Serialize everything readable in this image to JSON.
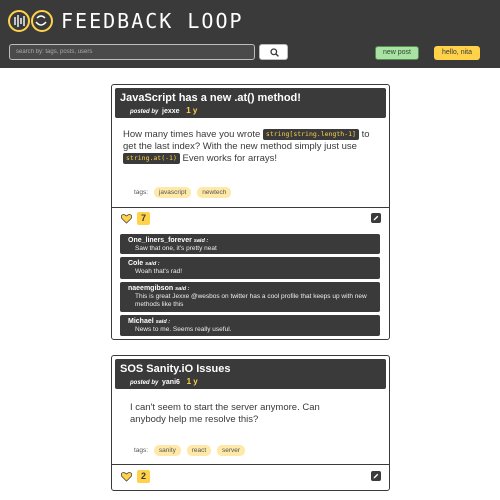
{
  "header": {
    "brand": "FEEDBACK LOOP",
    "search_placeholder": "search by: tags, posts, users",
    "new_post_label": "new post",
    "user_label": "hello, nita"
  },
  "posts": [
    {
      "title": "JavaScript has a new .at() method!",
      "posted_by_label": "posted by",
      "author": "jexxe",
      "age": "1 y",
      "body_1": "How many times have you wrote ",
      "code_1": "string[string.length-1]",
      "body_2": " to get the last index? With the new method simply just use ",
      "code_2": "string.at(-1)",
      "body_3": " Even works for arrays!",
      "tags_label": "tags:",
      "tags": [
        "javascript",
        "newtech"
      ],
      "likes": "7",
      "comments": [
        {
          "name": "One_liners_forever",
          "said": "said :",
          "text": "Saw that one, it's pretty neat"
        },
        {
          "name": "Cole",
          "said": "said :",
          "text": "Woah that's rad!"
        },
        {
          "name": "naeemgibson",
          "said": "said :",
          "text": "This is great Jexxe @wesbos on twitter has a cool profile that keeps up with new methods like this"
        },
        {
          "name": "Michael",
          "said": "said :",
          "text": "News to me. Seems really useful."
        }
      ]
    },
    {
      "title": "SOS Sanity.iO Issues",
      "posted_by_label": "posted by",
      "author": "yani6",
      "age": "1 y",
      "body": "I can't seem to start the server anymore. Can anybody help me resolve this?",
      "tags_label": "tags:",
      "tags": [
        "sanity",
        "react",
        "server"
      ],
      "likes": "2"
    }
  ],
  "colors": {
    "dark": "#3a3a3a",
    "accent_yellow": "#ffd24a",
    "tag_bg": "#ffe9a8",
    "new_post_green": "#a8e3a3"
  }
}
